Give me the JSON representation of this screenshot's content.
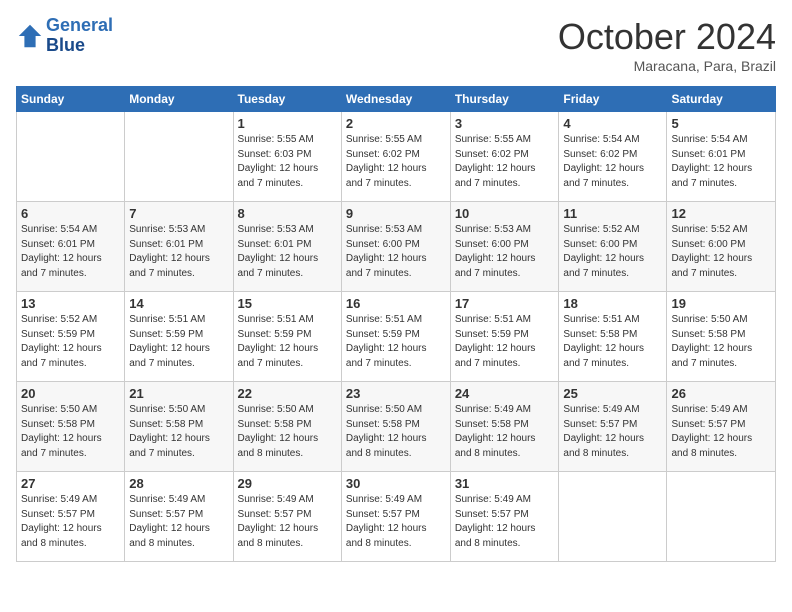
{
  "logo": {
    "line1": "General",
    "line2": "Blue"
  },
  "title": "October 2024",
  "subtitle": "Maracana, Para, Brazil",
  "days_of_week": [
    "Sunday",
    "Monday",
    "Tuesday",
    "Wednesday",
    "Thursday",
    "Friday",
    "Saturday"
  ],
  "weeks": [
    [
      {
        "day": "",
        "info": ""
      },
      {
        "day": "",
        "info": ""
      },
      {
        "day": "1",
        "info": "Sunrise: 5:55 AM\nSunset: 6:03 PM\nDaylight: 12 hours and 7 minutes."
      },
      {
        "day": "2",
        "info": "Sunrise: 5:55 AM\nSunset: 6:02 PM\nDaylight: 12 hours and 7 minutes."
      },
      {
        "day": "3",
        "info": "Sunrise: 5:55 AM\nSunset: 6:02 PM\nDaylight: 12 hours and 7 minutes."
      },
      {
        "day": "4",
        "info": "Sunrise: 5:54 AM\nSunset: 6:02 PM\nDaylight: 12 hours and 7 minutes."
      },
      {
        "day": "5",
        "info": "Sunrise: 5:54 AM\nSunset: 6:01 PM\nDaylight: 12 hours and 7 minutes."
      }
    ],
    [
      {
        "day": "6",
        "info": "Sunrise: 5:54 AM\nSunset: 6:01 PM\nDaylight: 12 hours and 7 minutes."
      },
      {
        "day": "7",
        "info": "Sunrise: 5:53 AM\nSunset: 6:01 PM\nDaylight: 12 hours and 7 minutes."
      },
      {
        "day": "8",
        "info": "Sunrise: 5:53 AM\nSunset: 6:01 PM\nDaylight: 12 hours and 7 minutes."
      },
      {
        "day": "9",
        "info": "Sunrise: 5:53 AM\nSunset: 6:00 PM\nDaylight: 12 hours and 7 minutes."
      },
      {
        "day": "10",
        "info": "Sunrise: 5:53 AM\nSunset: 6:00 PM\nDaylight: 12 hours and 7 minutes."
      },
      {
        "day": "11",
        "info": "Sunrise: 5:52 AM\nSunset: 6:00 PM\nDaylight: 12 hours and 7 minutes."
      },
      {
        "day": "12",
        "info": "Sunrise: 5:52 AM\nSunset: 6:00 PM\nDaylight: 12 hours and 7 minutes."
      }
    ],
    [
      {
        "day": "13",
        "info": "Sunrise: 5:52 AM\nSunset: 5:59 PM\nDaylight: 12 hours and 7 minutes."
      },
      {
        "day": "14",
        "info": "Sunrise: 5:51 AM\nSunset: 5:59 PM\nDaylight: 12 hours and 7 minutes."
      },
      {
        "day": "15",
        "info": "Sunrise: 5:51 AM\nSunset: 5:59 PM\nDaylight: 12 hours and 7 minutes."
      },
      {
        "day": "16",
        "info": "Sunrise: 5:51 AM\nSunset: 5:59 PM\nDaylight: 12 hours and 7 minutes."
      },
      {
        "day": "17",
        "info": "Sunrise: 5:51 AM\nSunset: 5:59 PM\nDaylight: 12 hours and 7 minutes."
      },
      {
        "day": "18",
        "info": "Sunrise: 5:51 AM\nSunset: 5:58 PM\nDaylight: 12 hours and 7 minutes."
      },
      {
        "day": "19",
        "info": "Sunrise: 5:50 AM\nSunset: 5:58 PM\nDaylight: 12 hours and 7 minutes."
      }
    ],
    [
      {
        "day": "20",
        "info": "Sunrise: 5:50 AM\nSunset: 5:58 PM\nDaylight: 12 hours and 7 minutes."
      },
      {
        "day": "21",
        "info": "Sunrise: 5:50 AM\nSunset: 5:58 PM\nDaylight: 12 hours and 7 minutes."
      },
      {
        "day": "22",
        "info": "Sunrise: 5:50 AM\nSunset: 5:58 PM\nDaylight: 12 hours and 8 minutes."
      },
      {
        "day": "23",
        "info": "Sunrise: 5:50 AM\nSunset: 5:58 PM\nDaylight: 12 hours and 8 minutes."
      },
      {
        "day": "24",
        "info": "Sunrise: 5:49 AM\nSunset: 5:58 PM\nDaylight: 12 hours and 8 minutes."
      },
      {
        "day": "25",
        "info": "Sunrise: 5:49 AM\nSunset: 5:57 PM\nDaylight: 12 hours and 8 minutes."
      },
      {
        "day": "26",
        "info": "Sunrise: 5:49 AM\nSunset: 5:57 PM\nDaylight: 12 hours and 8 minutes."
      }
    ],
    [
      {
        "day": "27",
        "info": "Sunrise: 5:49 AM\nSunset: 5:57 PM\nDaylight: 12 hours and 8 minutes."
      },
      {
        "day": "28",
        "info": "Sunrise: 5:49 AM\nSunset: 5:57 PM\nDaylight: 12 hours and 8 minutes."
      },
      {
        "day": "29",
        "info": "Sunrise: 5:49 AM\nSunset: 5:57 PM\nDaylight: 12 hours and 8 minutes."
      },
      {
        "day": "30",
        "info": "Sunrise: 5:49 AM\nSunset: 5:57 PM\nDaylight: 12 hours and 8 minutes."
      },
      {
        "day": "31",
        "info": "Sunrise: 5:49 AM\nSunset: 5:57 PM\nDaylight: 12 hours and 8 minutes."
      },
      {
        "day": "",
        "info": ""
      },
      {
        "day": "",
        "info": ""
      }
    ]
  ]
}
